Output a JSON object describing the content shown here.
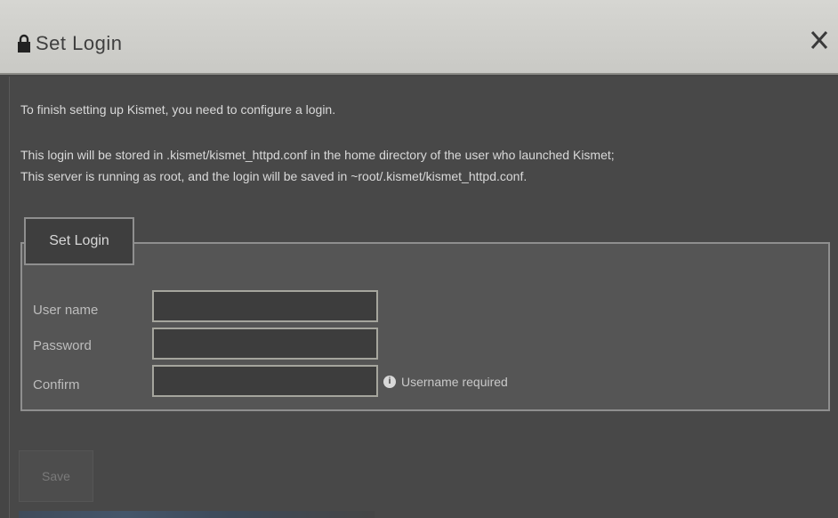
{
  "window": {
    "title": "Set Login",
    "title_icon": "lock-icon",
    "close_icon": "close-icon"
  },
  "messages": {
    "line1": "To finish setting up Kismet, you need to configure a login.",
    "line2": "This login will be stored in .kismet/kismet_httpd.conf in the home directory of the user who launched Kismet;",
    "line3": "This server is running as root, and the login will be saved in ~root/.kismet/kismet_httpd.conf."
  },
  "form": {
    "legend": "Set Login",
    "username_label": "User name",
    "password_label": "Password",
    "confirm_label": "Confirm",
    "username_value": "",
    "password_value": "",
    "confirm_value": "",
    "hint_icon": "info-icon",
    "hint_text": "Username required"
  },
  "actions": {
    "save_label": "Save"
  },
  "colors": {
    "titlebar": "#d0d0cc",
    "body": "#484848",
    "fieldset": "#555555",
    "input": "#3d3d3d"
  }
}
